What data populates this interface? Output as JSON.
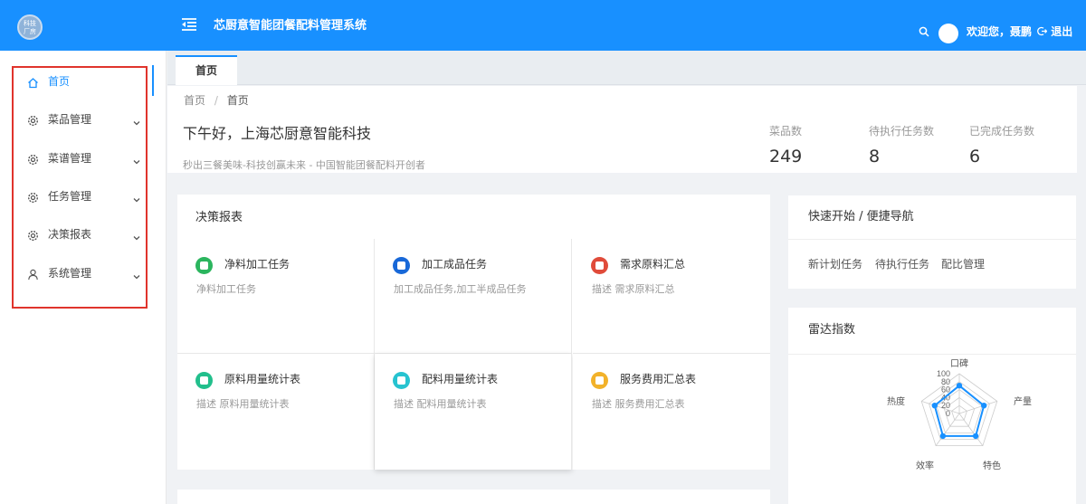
{
  "app": {
    "title": "芯厨意智能团餐配料管理系统",
    "logo_text": "科技\n厂房",
    "welcome": "欢迎您，聂鹏",
    "logout": "退出"
  },
  "sidebar": {
    "items": [
      {
        "label": "首页",
        "icon": "home-icon",
        "active": true
      },
      {
        "label": "菜品管理",
        "icon": "gear-icon",
        "active": false
      },
      {
        "label": "菜谱管理",
        "icon": "gear-icon",
        "active": false
      },
      {
        "label": "任务管理",
        "icon": "gear-icon",
        "active": false
      },
      {
        "label": "决策报表",
        "icon": "gear-icon",
        "active": false
      },
      {
        "label": "系统管理",
        "icon": "user-icon",
        "active": false
      }
    ]
  },
  "tabs": [
    {
      "label": "首页"
    }
  ],
  "breadcrumb": {
    "root": "首页",
    "separator": "/",
    "current": "首页"
  },
  "header": {
    "greeting": "下午好，上海芯厨意智能科技",
    "slogan": "秒出三餐美味-科技创赢未来 - 中国智能团餐配料开创者"
  },
  "stats": [
    {
      "label": "菜品数",
      "value": "249"
    },
    {
      "label": "待执行任务数",
      "value": "8"
    },
    {
      "label": "已完成任务数",
      "value": "6"
    }
  ],
  "report": {
    "title": "决策报表",
    "items": [
      {
        "title": "净料加工任务",
        "desc": "净料加工任务",
        "color": "#2bb55e",
        "icon": "clipboard-icon"
      },
      {
        "title": "加工成品任务",
        "desc": "加工成品任务,加工半成品任务",
        "color": "#1868d8",
        "icon": "document-icon"
      },
      {
        "title": "需求原料汇总",
        "desc": "描述 需求原料汇总",
        "color": "#e04b3a",
        "icon": "list-icon"
      },
      {
        "title": "原料用量统计表",
        "desc": "描述 原料用量统计表",
        "color": "#22bf8c",
        "icon": "table-icon"
      },
      {
        "title": "配料用量统计表",
        "desc": "描述 配料用量统计表",
        "color": "#27c3d0",
        "icon": "cube-icon"
      },
      {
        "title": "服务费用汇总表",
        "desc": "描述 服务费用汇总表",
        "color": "#f2b22a",
        "icon": "money-bag-icon"
      }
    ]
  },
  "quick_nav": {
    "title": "快速开始 / 便捷导航",
    "links": [
      "新计划任务",
      "待执行任务",
      "配比管理"
    ]
  },
  "radar": {
    "title": "雷达指数",
    "indicators": [
      "口碑",
      "产量",
      "特色",
      "效率",
      "热度"
    ],
    "ticks": [
      "100",
      "80",
      "60",
      "40",
      "20",
      "0"
    ],
    "values": [
      70,
      65,
      70,
      70,
      65
    ],
    "max": 100,
    "color": "#1890ff"
  },
  "colors": {
    "accent": "#1890ff",
    "highlight_frame": "#e0342c"
  }
}
